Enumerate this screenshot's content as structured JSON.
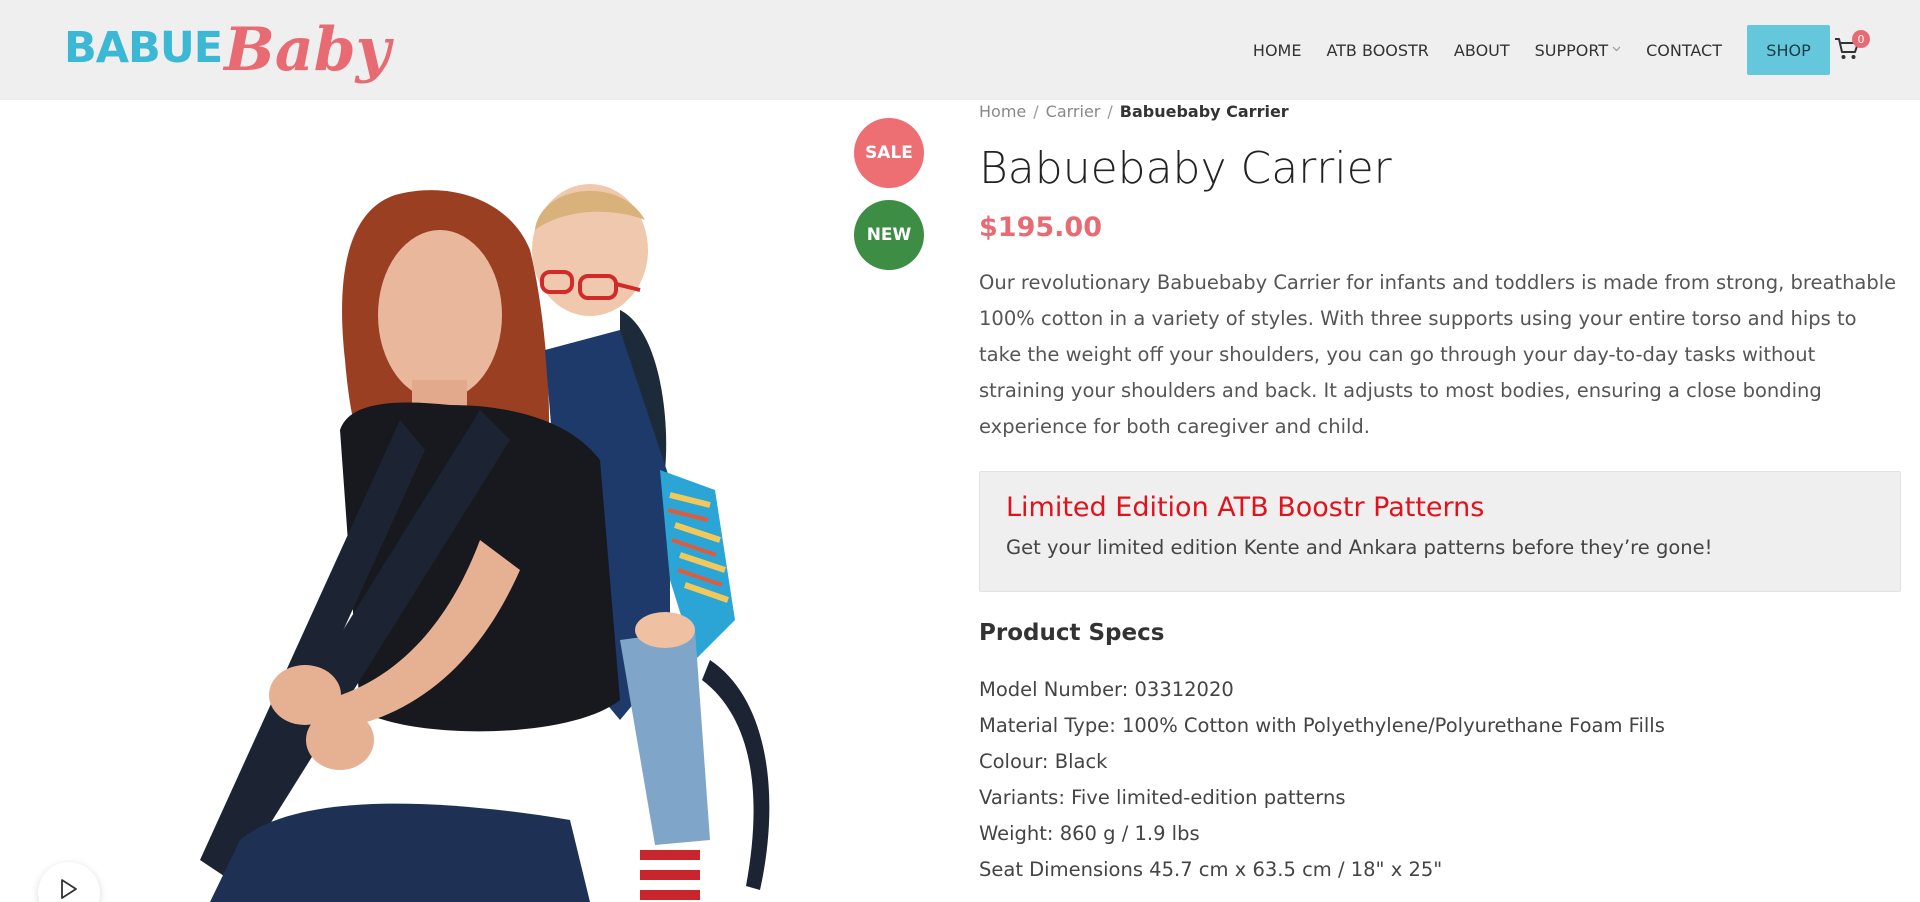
{
  "header": {
    "logo": {
      "part1": "BABUE",
      "part2": "Baby"
    },
    "nav": [
      {
        "label": "HOME"
      },
      {
        "label": "ATB BOOSTR"
      },
      {
        "label": "ABOUT"
      },
      {
        "label": "SUPPORT",
        "has_dropdown": true
      },
      {
        "label": "CONTACT"
      }
    ],
    "shop_label": "SHOP",
    "cart_count": "0"
  },
  "badges": {
    "sale": "SALE",
    "new": "NEW"
  },
  "product": {
    "breadcrumb": [
      "Home",
      "Carrier",
      "Babuebaby Carrier"
    ],
    "title": "Babuebaby Carrier",
    "price": "$195.00",
    "description": "Our revolutionary Babuebaby Carrier for infants and toddlers is made from strong, breathable 100% cotton in a variety of styles. With three supports using your entire torso and hips to take the weight off your shoulders, you can go through your day-to-day tasks without straining your shoulders and back. It adjusts to most bodies, ensuring a close bonding experience for both caregiver and child.",
    "promo": {
      "title": "Limited Edition ATB Boostr Patterns",
      "text": "Get your limited edition Kente and Ankara patterns before they’re gone!"
    },
    "specs_title": "Product Specs",
    "specs": [
      "Model Number: 03312020",
      "Material Type: 100% Cotton with Polyethylene/Polyurethane Foam Fills",
      "Colour: Black",
      "Variants: Five limited-edition patterns",
      "Weight: 860 g / 1.9 lbs",
      "Seat Dimensions 45.7 cm x 63.5 cm / 18\" x 25\""
    ]
  },
  "colors": {
    "accent_blue": "#3bb8d4",
    "accent_pink": "#e86b74",
    "shop_button": "#65c7dc",
    "sale_badge": "#ee6f73",
    "new_badge": "#3e8d45",
    "promo_title": "#e0131d"
  },
  "icons": [
    "cart-icon",
    "chevron-down-icon",
    "play-icon"
  ]
}
